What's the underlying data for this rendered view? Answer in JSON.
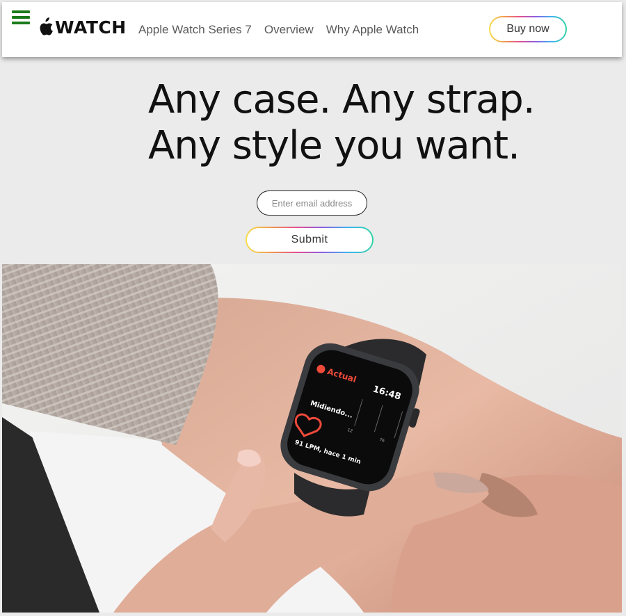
{
  "header": {
    "logo_text": "WATCH",
    "nav": [
      "Apple Watch Series 7",
      "Overview",
      "Why Apple Watch"
    ],
    "buy_label": "Buy now"
  },
  "hero": {
    "headline_line1": "Any case. Any strap.",
    "headline_line2": "Any style you want.",
    "email_placeholder": "Enter email address",
    "submit_label": "Submit"
  },
  "watch_screen": {
    "app_label": "Actual",
    "time": "16:48",
    "status": "Midiendo...",
    "reading": "91 LPM, hace 1 min",
    "tick_labels": [
      "12",
      "76"
    ]
  },
  "colors": {
    "menu_icon": "#1b7a1b",
    "gradient": [
      "#f6e04a",
      "#f09a4f",
      "#e64f8f",
      "#8c5de2",
      "#3fb2f1",
      "#2fd4a4"
    ]
  }
}
